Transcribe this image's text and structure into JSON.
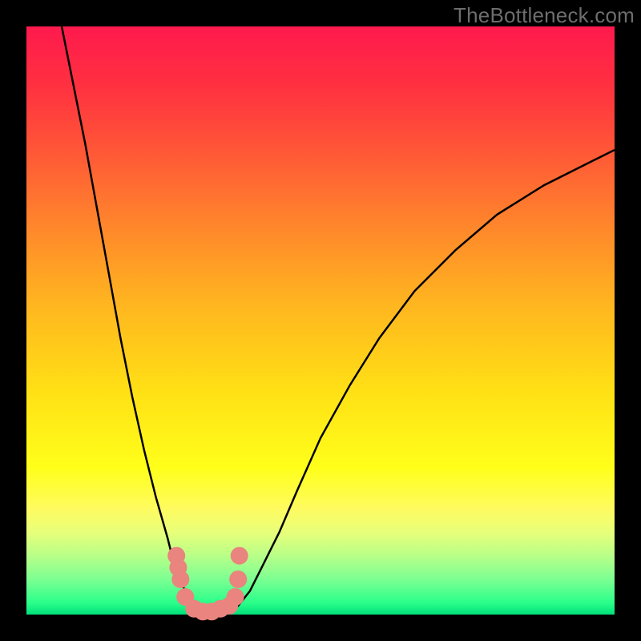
{
  "watermark": "TheBottleneck.com",
  "chart_data": {
    "type": "line",
    "title": "",
    "xlabel": "",
    "ylabel": "",
    "xlim": [
      0,
      100
    ],
    "ylim": [
      0,
      100
    ],
    "grid": false,
    "legend": false,
    "background_gradient": [
      "#ff1a4d",
      "#ffe015",
      "#00e07a"
    ],
    "series": [
      {
        "name": "left-branch",
        "x": [
          6,
          8,
          10,
          12,
          14,
          16,
          18,
          20,
          22,
          24,
          25,
          26,
          27,
          28,
          29,
          29.5
        ],
        "y": [
          100,
          90,
          80,
          69,
          58,
          47,
          37,
          28,
          20,
          13,
          9,
          6,
          4,
          2.5,
          1.2,
          0.5
        ]
      },
      {
        "name": "right-branch",
        "x": [
          35,
          36,
          38,
          40,
          43,
          46,
          50,
          55,
          60,
          66,
          73,
          80,
          88,
          96,
          100
        ],
        "y": [
          0.5,
          1.5,
          4,
          8,
          14,
          21,
          30,
          39,
          47,
          55,
          62,
          68,
          73,
          77,
          79
        ]
      },
      {
        "name": "highlight-dots",
        "style": "marker",
        "x": [
          25.5,
          25.8,
          26.2,
          27.0,
          28.5,
          30.0,
          31.5,
          33.0,
          34.5,
          35.5,
          36.0,
          36.2
        ],
        "y": [
          10.0,
          8.0,
          6.0,
          3.0,
          1.0,
          0.5,
          0.5,
          1.0,
          1.5,
          3.0,
          6.0,
          10.0
        ]
      }
    ]
  }
}
